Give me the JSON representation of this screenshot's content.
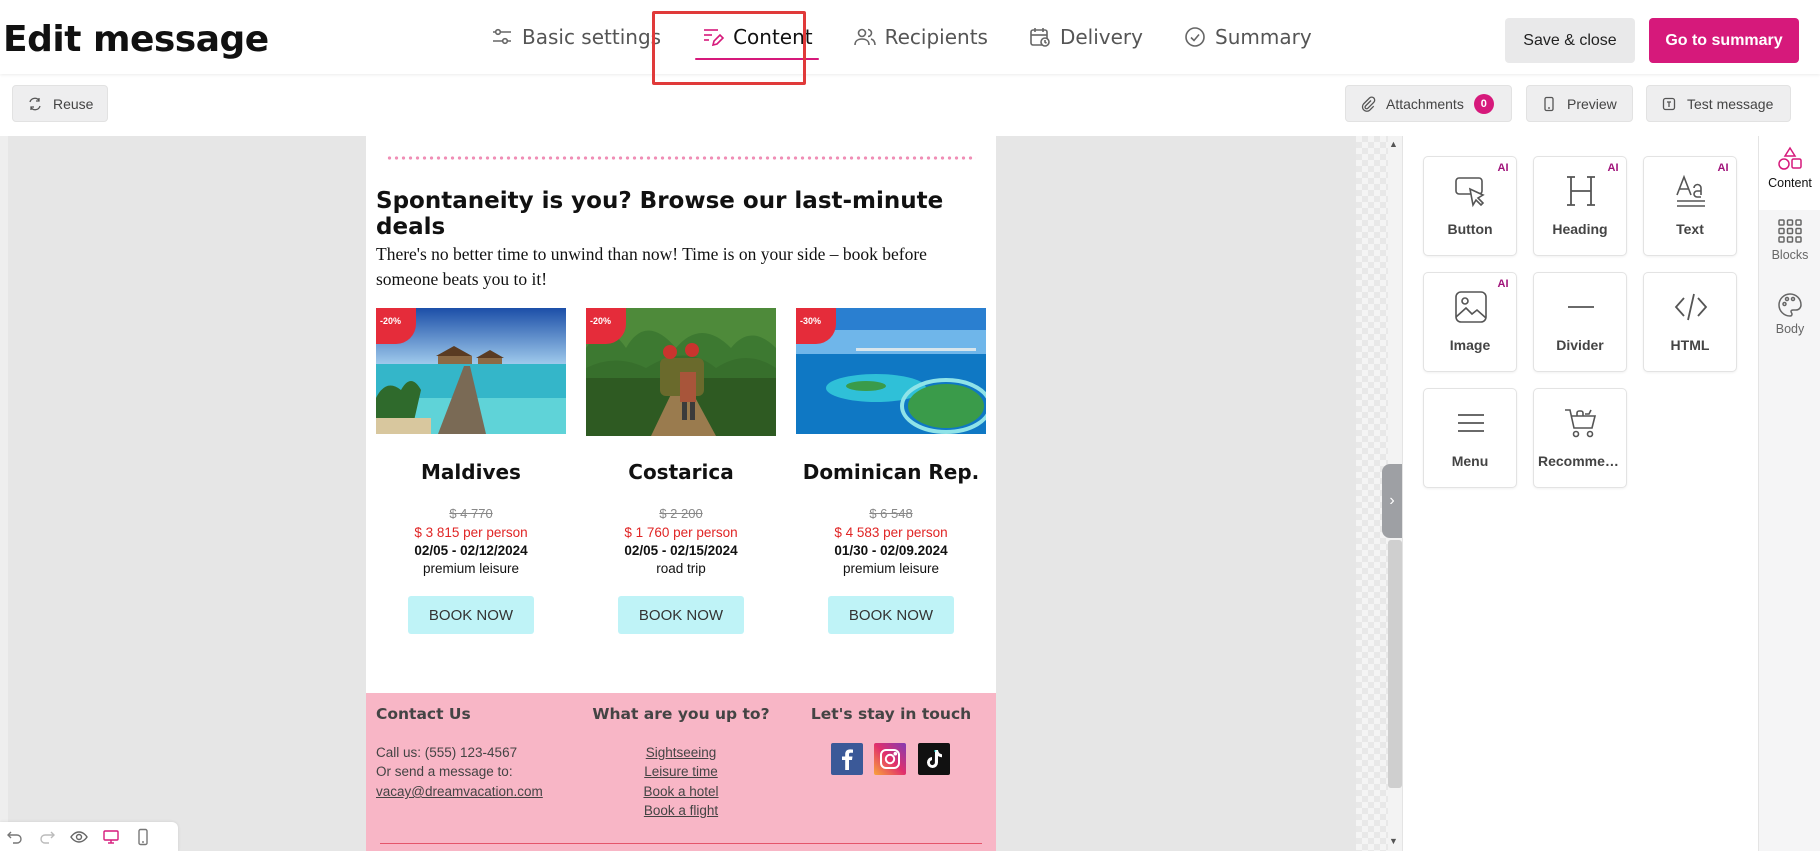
{
  "header": {
    "title": "Edit message",
    "tabs": [
      {
        "label": "Basic settings"
      },
      {
        "label": "Content"
      },
      {
        "label": "Recipients"
      },
      {
        "label": "Delivery"
      },
      {
        "label": "Summary"
      }
    ],
    "active_tab": "Content",
    "save_label": "Save & close",
    "summary_label": "Go to summary"
  },
  "toolbar": {
    "reuse": "Reuse",
    "attachments": "Attachments",
    "attachments_count": "0",
    "preview": "Preview",
    "test_message": "Test message"
  },
  "email": {
    "heading": "Spontaneity is you? Browse our last-minute deals",
    "intro": "There's no better time to unwind than now! Time is on your side – book before someone beats you to it!",
    "deals": [
      {
        "discount": "-20%",
        "name": "Maldives",
        "old_price": "$ 4 770",
        "new_price": "$ 3 815 per person",
        "dates": "02/05 - 02/12/2024",
        "type": "premium leisure",
        "button": "BOOK NOW"
      },
      {
        "discount": "-20%",
        "name": "Costarica",
        "old_price": "$ 2 200",
        "new_price": "$ 1 760 per person",
        "dates": "02/05 - 02/15/2024",
        "type": "road trip",
        "button": "BOOK NOW"
      },
      {
        "discount": "-30%",
        "name": "Dominican Rep.",
        "old_price": "$ 6 548",
        "new_price": "$ 4 583 per person",
        "dates": "01/30  - 02/09.2024",
        "type": "premium leisure",
        "button": "BOOK NOW"
      }
    ],
    "footer": {
      "contact_heading": "Contact Us",
      "call": "Call us: (555) 123-4567",
      "send": "Or send a message to:",
      "email": "vacay@dreamvacation.com",
      "upto_heading": "What are you up to?",
      "links": [
        "Sightseeing",
        "Leisure time",
        "Book a hotel",
        "Book a flight"
      ],
      "social_heading": "Let's stay in touch",
      "social_icons": [
        "facebook-icon",
        "instagram-icon",
        "tiktok-icon"
      ]
    }
  },
  "panel": {
    "tiles": [
      {
        "label": "Button",
        "ai": "AI"
      },
      {
        "label": "Heading",
        "ai": "AI"
      },
      {
        "label": "Text",
        "ai": "AI"
      },
      {
        "label": "Image",
        "ai": "AI"
      },
      {
        "label": "Divider"
      },
      {
        "label": "HTML"
      },
      {
        "label": "Menu"
      },
      {
        "label": "Recommen..."
      }
    ]
  },
  "sidebar": {
    "items": [
      {
        "label": "Content"
      },
      {
        "label": "Blocks"
      },
      {
        "label": "Body"
      }
    ]
  },
  "colors": {
    "accent": "#d6197b",
    "footer_bg": "#f8b6c6",
    "book_button": "#bff3f7",
    "price_red": "#e02424"
  }
}
